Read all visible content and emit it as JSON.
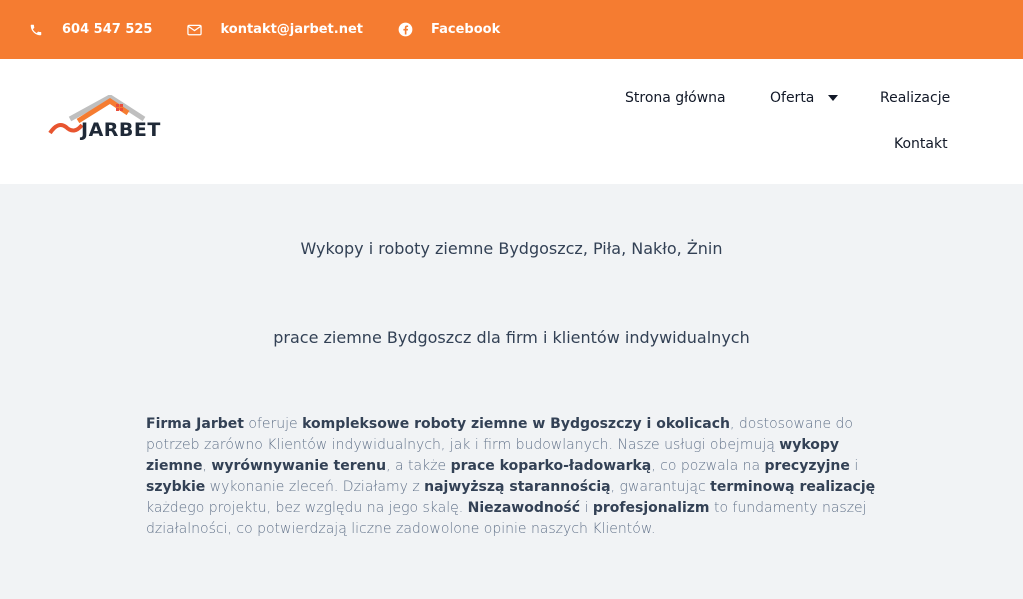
{
  "topbar": {
    "phone": "604 547 525",
    "email": "kontakt@jarbet.net",
    "facebook": "Facebook",
    "color": "#f57c31"
  },
  "logo": {
    "brand": "JARBET"
  },
  "nav": {
    "home": "Strona główna",
    "offer": "Oferta",
    "realizations": "Realizacje",
    "contact": "Kontakt"
  },
  "main": {
    "heading1": "Wykopy i roboty ziemne Bydgoszcz, Piła, Nakło, Żnin",
    "heading2": "prace ziemne Bydgoszcz dla firm i klientów indywidualnych",
    "paragraph": [
      {
        "t": "Firma Jarbet",
        "b": true
      },
      {
        "t": " oferuje ",
        "b": false
      },
      {
        "t": "kompleksowe roboty ziemne w Bydgoszczy i okolicach",
        "b": true
      },
      {
        "t": ", dostosowane do potrzeb zarówno Klientów indywidualnych, jak i firm budowlanych. Nasze usługi obejmują ",
        "b": false
      },
      {
        "t": "wykopy ziemne",
        "b": true
      },
      {
        "t": ", ",
        "b": false
      },
      {
        "t": "wyrównywanie terenu",
        "b": true
      },
      {
        "t": ", a także ",
        "b": false
      },
      {
        "t": "prace koparko-ładowarką",
        "b": true
      },
      {
        "t": ", co pozwala na ",
        "b": false
      },
      {
        "t": "precyzyjne",
        "b": true
      },
      {
        "t": " i ",
        "b": false
      },
      {
        "t": "szybkie",
        "b": true
      },
      {
        "t": " wykonanie zleceń. Działamy z ",
        "b": false
      },
      {
        "t": "najwyższą starannością",
        "b": true
      },
      {
        "t": ", gwarantując ",
        "b": false
      },
      {
        "t": "terminową realizację",
        "b": true
      },
      {
        "t": " każdego projektu, bez względu na jego skalę. ",
        "b": false
      },
      {
        "t": "Niezawodność",
        "b": true
      },
      {
        "t": " i ",
        "b": false
      },
      {
        "t": "profesjonalizm",
        "b": true
      },
      {
        "t": " to fundamenty naszej działalności, co potwierdzają liczne zadowolone opinie naszych Klientów.",
        "b": false
      }
    ]
  }
}
